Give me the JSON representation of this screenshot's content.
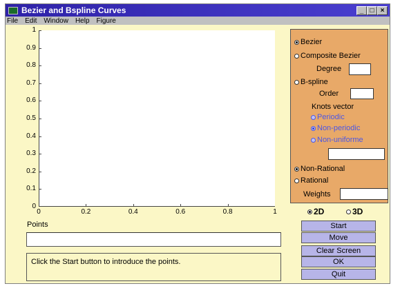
{
  "window": {
    "title": "Bezier and Bspline Curves",
    "controls": [
      "_",
      "□",
      "×"
    ]
  },
  "menu": [
    "File",
    "Edit",
    "Window",
    "Help",
    "Figure"
  ],
  "plot": {
    "yticks": [
      "1",
      "0.9",
      "0.8",
      "0.7",
      "0.6",
      "0.5",
      "0.4",
      "0.3",
      "0.2",
      "0.1",
      "0"
    ],
    "xticks": [
      "0",
      "0.2",
      "0.4",
      "0.6",
      "0.8",
      "1"
    ]
  },
  "points_label": "Points",
  "points_value": "",
  "status_text": "Click the Start button to introduce the points.",
  "panel": {
    "bezier": "Bezier",
    "composite": "Composite Bezier",
    "degree_label": "Degree",
    "degree_value": "",
    "bspline": "B-spline",
    "order_label": "Order",
    "order_value": "",
    "knots_label": "Knots vector",
    "periodic": "Periodic",
    "nonperiodic": "Non-periodic",
    "nonuniform": "Non-uniforme",
    "knots_value": "",
    "nonrational": "Non-Rational",
    "rational": "Rational",
    "weights_label": "Weights",
    "weights_value": ""
  },
  "dims": {
    "d2": "2D",
    "d3": "3D"
  },
  "buttons": {
    "start": "Start",
    "move": "Move",
    "clear": "Clear Screen",
    "ok": "OK",
    "quit": "Quit"
  },
  "colors": {
    "titlebar": "#2e22a8",
    "background": "#fbf7c6",
    "panel": "#e8a968",
    "button": "#b7b5e8",
    "disabled_text": "#4b56e6"
  }
}
